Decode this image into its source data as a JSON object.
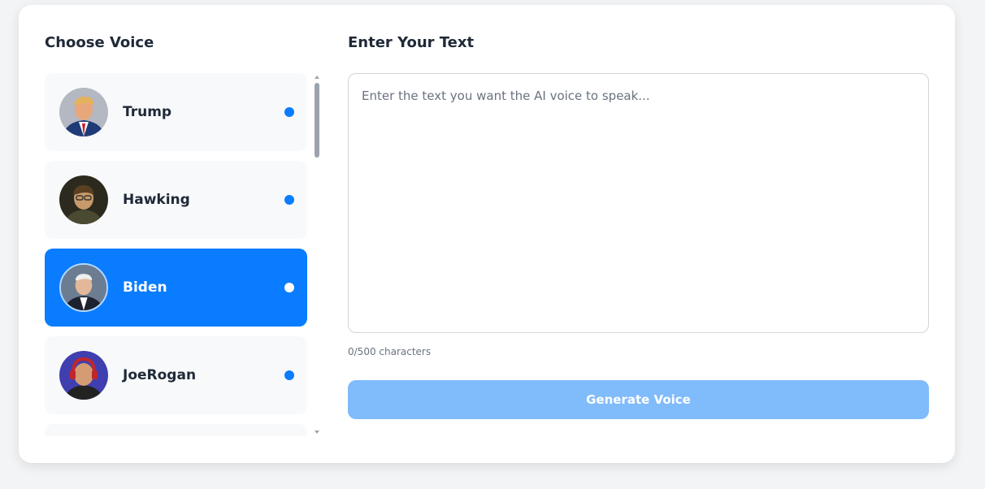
{
  "voice_panel": {
    "title": "Choose Voice",
    "items": [
      {
        "name": "Trump",
        "selected": false
      },
      {
        "name": "Hawking",
        "selected": false
      },
      {
        "name": "Biden",
        "selected": true
      },
      {
        "name": "JoeRogan",
        "selected": false
      },
      {
        "name": "",
        "selected": false
      }
    ]
  },
  "text_panel": {
    "title": "Enter Your Text",
    "input_value": "",
    "input_placeholder": "Enter the text you want the AI voice to speak...",
    "char_count": "0/500 characters",
    "generate_label": "Generate Voice"
  },
  "colors": {
    "accent": "#0a7cff",
    "button_disabled": "#80bbfb",
    "card_background": "#ffffff",
    "page_background": "#f3f4f6"
  },
  "icons": [
    "selection-dot-icon",
    "scroll-up-icon",
    "scroll-down-icon"
  ]
}
